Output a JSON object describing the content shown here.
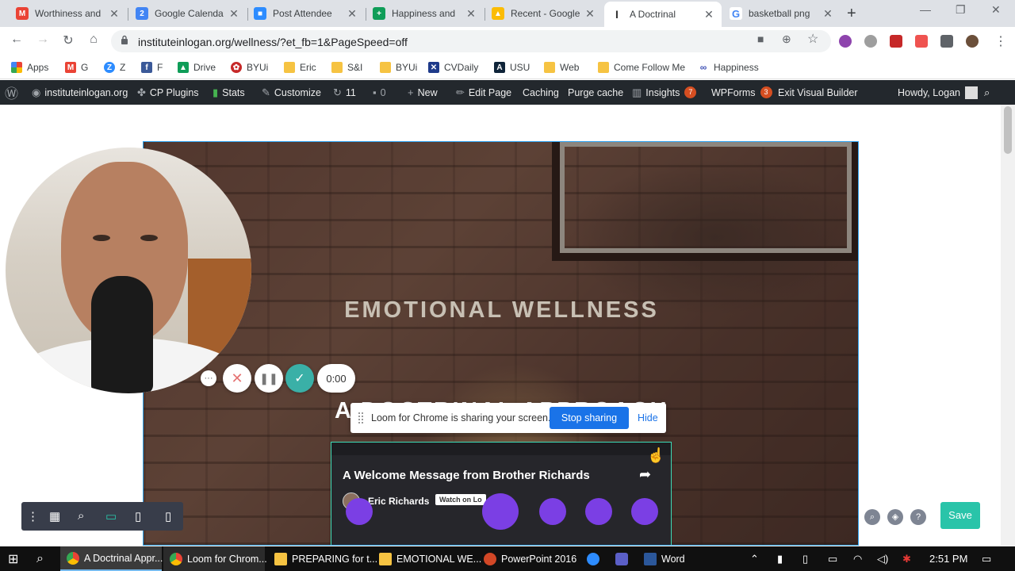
{
  "browser": {
    "tabs": [
      {
        "title": "Worthiness and",
        "icon": "gmail-icon",
        "color": "#ea4335"
      },
      {
        "title": "Google Calenda",
        "icon": "calendar-icon",
        "color": "#4285f4"
      },
      {
        "title": "Post Attendee",
        "icon": "zoom-icon",
        "color": "#2d8cff"
      },
      {
        "title": "Happiness and",
        "icon": "sheets-icon",
        "color": "#0f9d58"
      },
      {
        "title": "Recent - Google",
        "icon": "drive-icon",
        "color": "#fbbc04"
      },
      {
        "title": "A Doctrinal",
        "icon": "site-icon",
        "color": "#333333"
      },
      {
        "title": "basketball png",
        "icon": "google-icon",
        "color": "#4285f4"
      }
    ],
    "url": "instituteinlogan.org/wellness/?et_fb=1&PageSpeed=off"
  },
  "bookmarks": [
    {
      "label": "Apps",
      "icon": "apps-grid-icon"
    },
    {
      "label": "G",
      "icon": "gmail-icon"
    },
    {
      "label": "Z",
      "icon": "zoom-icon"
    },
    {
      "label": "F",
      "icon": "facebook-icon"
    },
    {
      "label": "Drive",
      "icon": "drive-icon"
    },
    {
      "label": "BYUi",
      "icon": "byui-icon"
    },
    {
      "label": "Eric",
      "icon": "folder-icon"
    },
    {
      "label": "S&I",
      "icon": "folder-icon"
    },
    {
      "label": "BYUi",
      "icon": "folder-icon"
    },
    {
      "label": "CVDaily",
      "icon": "cvdaily-icon"
    },
    {
      "label": "USU",
      "icon": "usu-icon"
    },
    {
      "label": "Web",
      "icon": "folder-icon"
    },
    {
      "label": "Come Follow Me",
      "icon": "folder-icon"
    },
    {
      "label": "Happiness",
      "icon": "link-icon"
    }
  ],
  "wpbar": {
    "site": "instituteinlogan.org",
    "cp_plugins": "CP Plugins",
    "stats": "Stats",
    "customize": "Customize",
    "updates_count": "11",
    "comments_count": "0",
    "new": "New",
    "edit_page": "Edit Page",
    "caching": "Caching",
    "purge_cache": "Purge cache",
    "insights": "Insights",
    "insights_badge": "7",
    "wpforms": "WPForms",
    "wpforms_badge": "3",
    "exit_builder": "Exit Visual Builder",
    "howdy": "Howdy, Logan"
  },
  "hero": {
    "title": "EMOTIONAL WELLNESS",
    "subtitle": "A DOCTRINAL APPROACH"
  },
  "video": {
    "title": "A Welcome Message from Brother Richards",
    "author": "Eric Richards",
    "watch_label": "Watch on Lo"
  },
  "loom": {
    "timer": "0:00",
    "sharing_message": "Loom for Chrome is sharing your screen.",
    "stop_label": "Stop sharing",
    "hide_label": "Hide"
  },
  "divi": {
    "save_label": "Save"
  },
  "taskbar": {
    "apps": [
      {
        "label": "A Doctrinal Appr...",
        "icon": "chrome-icon"
      },
      {
        "label": "Loom for Chrom...",
        "icon": "chrome-icon"
      },
      {
        "label": "PREPARING for t...",
        "icon": "folder-icon"
      },
      {
        "label": "EMOTIONAL WE...",
        "icon": "folder-icon"
      },
      {
        "label": "PowerPoint 2016",
        "icon": "powerpoint-icon"
      },
      {
        "label": "Word",
        "icon": "word-icon"
      }
    ],
    "clock": "2:51 PM"
  }
}
